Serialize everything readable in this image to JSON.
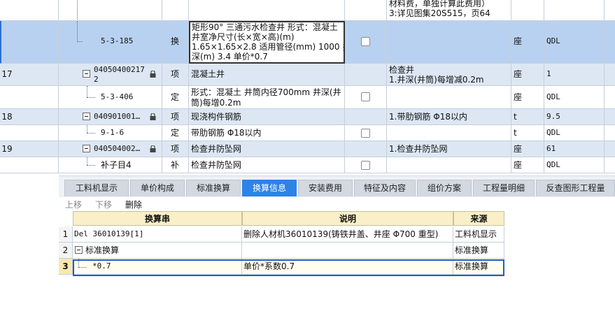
{
  "top_grid": {
    "rows": [
      {
        "no": "",
        "code": "",
        "type": "",
        "name": "",
        "feature_lines": [
          "材料费，单独计算此费用）",
          "3:详见图集20S515，页64"
        ],
        "unit": "",
        "qty": ""
      },
      {
        "no": "",
        "code": "5-3-185",
        "type": "换",
        "name_lines": [
          "矩形90° 三通污水检查井 形式：混凝土",
          "井室净尺寸(长×宽×高)(m)",
          "1.65×1.65×2.8 适用管径(mm) 1000 井",
          "深(m) 3.4  单价*0.7"
        ],
        "feature_lines": [],
        "unit": "座",
        "qty": "QDL"
      },
      {
        "no": "17",
        "code_lines": [
          "04050400217",
          "2"
        ],
        "type": "项",
        "name": "混凝土井",
        "feature_lines": [
          "检查井",
          "1.井深(井筒)每增减0.2m"
        ],
        "unit": "座",
        "qty": "1"
      },
      {
        "no": "",
        "code": "5-3-406",
        "type": "定",
        "name_lines": [
          "形式：混凝土 井筒内径700mm 井深(井",
          "筒)每增0.2m"
        ],
        "feature_lines": [],
        "unit": "座",
        "qty": "QDL"
      },
      {
        "no": "18",
        "code": "040901001…",
        "type": "项",
        "name": "现浇构件钢筋",
        "feature_lines": [
          "1.带肋钢筋 Φ18以内"
        ],
        "unit": "t",
        "qty": "9.5"
      },
      {
        "no": "",
        "code": "9-1-6",
        "type": "定",
        "name": "带肋钢筋 Φ18以内",
        "feature_lines": [],
        "unit": "t",
        "qty": "QDL"
      },
      {
        "no": "19",
        "code": "040504002…",
        "type": "项",
        "name": "检查井防坠网",
        "feature_lines": [
          "1.检查井防坠网"
        ],
        "unit": "座",
        "qty": "61"
      },
      {
        "no": "",
        "code": "补子目4",
        "type": "补",
        "name": "检查井防坠网",
        "feature_lines": [],
        "unit": "座",
        "qty": "QDL"
      }
    ]
  },
  "tabs": [
    {
      "label": "工料机显示",
      "active": false
    },
    {
      "label": "单价构成",
      "active": false
    },
    {
      "label": "标准换算",
      "active": false
    },
    {
      "label": "换算信息",
      "active": true
    },
    {
      "label": "安装费用",
      "active": false
    },
    {
      "label": "特征及内容",
      "active": false
    },
    {
      "label": "组价方案",
      "active": false
    },
    {
      "label": "工程量明细",
      "active": false
    },
    {
      "label": "反查图形工程量",
      "active": false
    }
  ],
  "toolbar": {
    "move_up": "上移",
    "move_down": "下移",
    "delete": "删除"
  },
  "bottom_grid": {
    "headers": {
      "string": "换算串",
      "desc": "说明",
      "source": "来源"
    },
    "rows": [
      {
        "no": "1",
        "string": "Del 36010139[1]",
        "desc": "删除人材机36010139(铸铁井盖、井座 Φ700 重型)",
        "source": "工料机显示"
      },
      {
        "no": "2",
        "string": "标准换算",
        "desc": "",
        "source": "标准换算"
      },
      {
        "no": "3",
        "string": "*0.7",
        "desc": "单价*系数0.7",
        "source": "标准换算"
      }
    ]
  },
  "colors": {
    "active_tab": "#2d83e6",
    "selected_row": "#b9d1f1",
    "alt_row": "#dde7f4",
    "header_bg": "#f9efc8",
    "selection_border": "#1f5fc4"
  }
}
